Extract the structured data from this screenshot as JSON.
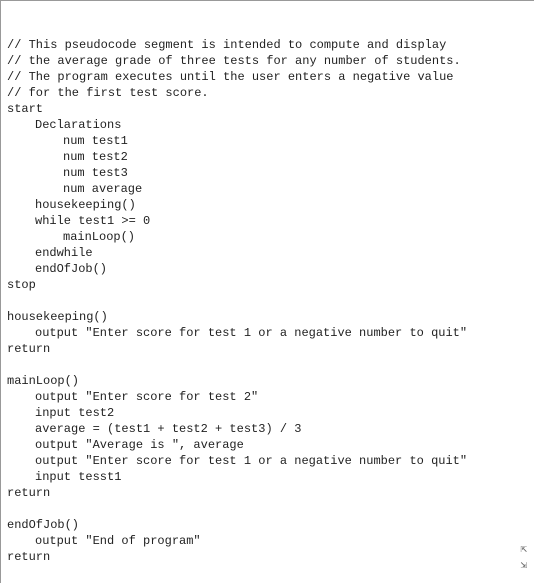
{
  "code": {
    "lines": [
      {
        "indent": 0,
        "text": "// This pseudocode segment is intended to compute and display"
      },
      {
        "indent": 0,
        "text": "// the average grade of three tests for any number of students."
      },
      {
        "indent": 0,
        "text": "// The program executes until the user enters a negative value"
      },
      {
        "indent": 0,
        "text": "// for the first test score."
      },
      {
        "indent": 0,
        "text": "start"
      },
      {
        "indent": 1,
        "text": "Declarations"
      },
      {
        "indent": 2,
        "text": "num test1"
      },
      {
        "indent": 2,
        "text": "num test2"
      },
      {
        "indent": 2,
        "text": "num test3"
      },
      {
        "indent": 2,
        "text": "num average"
      },
      {
        "indent": 1,
        "text": "housekeeping()"
      },
      {
        "indent": 1,
        "text": "while test1 >= 0"
      },
      {
        "indent": 2,
        "text": "mainLoop()"
      },
      {
        "indent": 1,
        "text": "endwhile"
      },
      {
        "indent": 1,
        "text": "endOfJob()"
      },
      {
        "indent": 0,
        "text": "stop"
      },
      {
        "indent": 0,
        "text": ""
      },
      {
        "indent": 0,
        "text": "housekeeping()"
      },
      {
        "indent": 1,
        "text": "output \"Enter score for test 1 or a negative number to quit\""
      },
      {
        "indent": 0,
        "text": "return"
      },
      {
        "indent": 0,
        "text": ""
      },
      {
        "indent": 0,
        "text": "mainLoop()"
      },
      {
        "indent": 1,
        "text": "output \"Enter score for test 2\""
      },
      {
        "indent": 1,
        "text": "input test2"
      },
      {
        "indent": 1,
        "text": "average = (test1 + test2 + test3) / 3"
      },
      {
        "indent": 1,
        "text": "output \"Average is \", average"
      },
      {
        "indent": 1,
        "text": "output \"Enter score for test 1 or a negative number to quit\""
      },
      {
        "indent": 1,
        "text": "input tesst1"
      },
      {
        "indent": 0,
        "text": "return"
      },
      {
        "indent": 0,
        "text": ""
      },
      {
        "indent": 0,
        "text": "endOfJob()"
      },
      {
        "indent": 1,
        "text": "output \"End of program\""
      },
      {
        "indent": 0,
        "text": "return"
      }
    ]
  },
  "icons": {
    "collapse_glyph_top": "⇱",
    "collapse_glyph_bottom": "⇲"
  }
}
